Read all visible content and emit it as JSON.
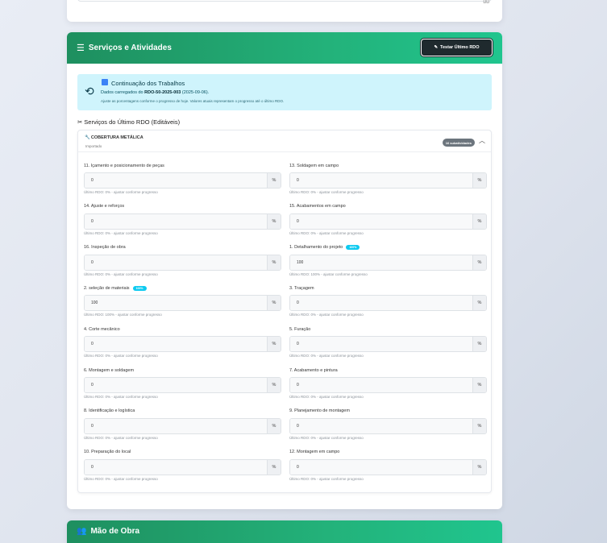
{
  "top_card": {
    "icon": "calendar-mini-icon",
    "glyph": "▯▯"
  },
  "services_card": {
    "title": "Serviços e Atividades",
    "title_icon": "list-check-icon",
    "test_button": "Testar Último RDO",
    "test_button_icon": "pencil-icon",
    "info": {
      "title": "Continuação dos Trabalhos",
      "line_prefix": "Dados carregados do ",
      "rdo_code": "RDO-50-2025-003",
      "line_suffix": " (2025-09-06).",
      "note": "Ajuste as porcentagens conforme o progresso de hoje. Valores atuais representam o progresso até o último RDO."
    },
    "section_title": "Serviços do Último RDO (Editáveis)",
    "service": {
      "name": "COBERTURA METÁLICA",
      "subtitle": "Importado",
      "badge": "16 subatividades",
      "subactivities": [
        {
          "label": "11. Içamento e posicionamento de peças",
          "value": "0",
          "unit": "%",
          "hint": "Último RDO: 0% - ajustar conforme progresso",
          "badge": ""
        },
        {
          "label": "13. Soldagem em campo",
          "value": "0",
          "unit": "%",
          "hint": "Último RDO: 0% - ajustar conforme progresso",
          "badge": ""
        },
        {
          "label": "14. Ajuste e reforços",
          "value": "0",
          "unit": "%",
          "hint": "Último RDO: 0% - ajustar conforme progresso",
          "badge": ""
        },
        {
          "label": "15. Acabamentos em campo",
          "value": "0",
          "unit": "%",
          "hint": "Último RDO: 0% - ajustar conforme progresso",
          "badge": ""
        },
        {
          "label": "16. Inspeção de obra",
          "value": "0",
          "unit": "%",
          "hint": "Último RDO: 0% - ajustar conforme progresso",
          "badge": ""
        },
        {
          "label": "1. Detalhamento do projeto",
          "value": "100",
          "unit": "%",
          "hint": "Último RDO: 100% - ajustar conforme progresso",
          "badge": "100%"
        },
        {
          "label": "2. seleção de materiais",
          "value": "100",
          "unit": "%",
          "hint": "Último RDO: 100% - ajustar conforme progresso",
          "badge": "100%"
        },
        {
          "label": "3. Traçagem",
          "value": "0",
          "unit": "%",
          "hint": "Último RDO: 0% - ajustar conforme progresso",
          "badge": ""
        },
        {
          "label": "4. Corte mecânico",
          "value": "0",
          "unit": "%",
          "hint": "Último RDO: 0% - ajustar conforme progresso",
          "badge": ""
        },
        {
          "label": "5. Furação",
          "value": "0",
          "unit": "%",
          "hint": "Último RDO: 0% - ajustar conforme progresso",
          "badge": ""
        },
        {
          "label": "6. Montagem e soldagem",
          "value": "0",
          "unit": "%",
          "hint": "Último RDO: 0% - ajustar conforme progresso",
          "badge": ""
        },
        {
          "label": "7. Acabamento e pintura",
          "value": "0",
          "unit": "%",
          "hint": "Último RDO: 0% - ajustar conforme progresso",
          "badge": ""
        },
        {
          "label": "8. Identificação e logística",
          "value": "0",
          "unit": "%",
          "hint": "Último RDO: 0% - ajustar conforme progresso",
          "badge": ""
        },
        {
          "label": "9. Planejamento de montagem",
          "value": "0",
          "unit": "%",
          "hint": "Último RDO: 0% - ajustar conforme progresso",
          "badge": ""
        },
        {
          "label": "10. Preparação do local",
          "value": "0",
          "unit": "%",
          "hint": "Último RDO: 0% - ajustar conforme progresso",
          "badge": ""
        },
        {
          "label": "12. Montagem em campo",
          "value": "0",
          "unit": "%",
          "hint": "Último RDO: 0% - ajustar conforme progresso",
          "badge": ""
        }
      ]
    }
  },
  "labor_card": {
    "title": "Mão de Obra",
    "title_icon": "users-icon"
  },
  "colors": {
    "header_green": "#23b27a",
    "info_bg": "#cff4fc",
    "badge_cyan": "#0dcaf0",
    "badge_gray": "#6c757d"
  }
}
